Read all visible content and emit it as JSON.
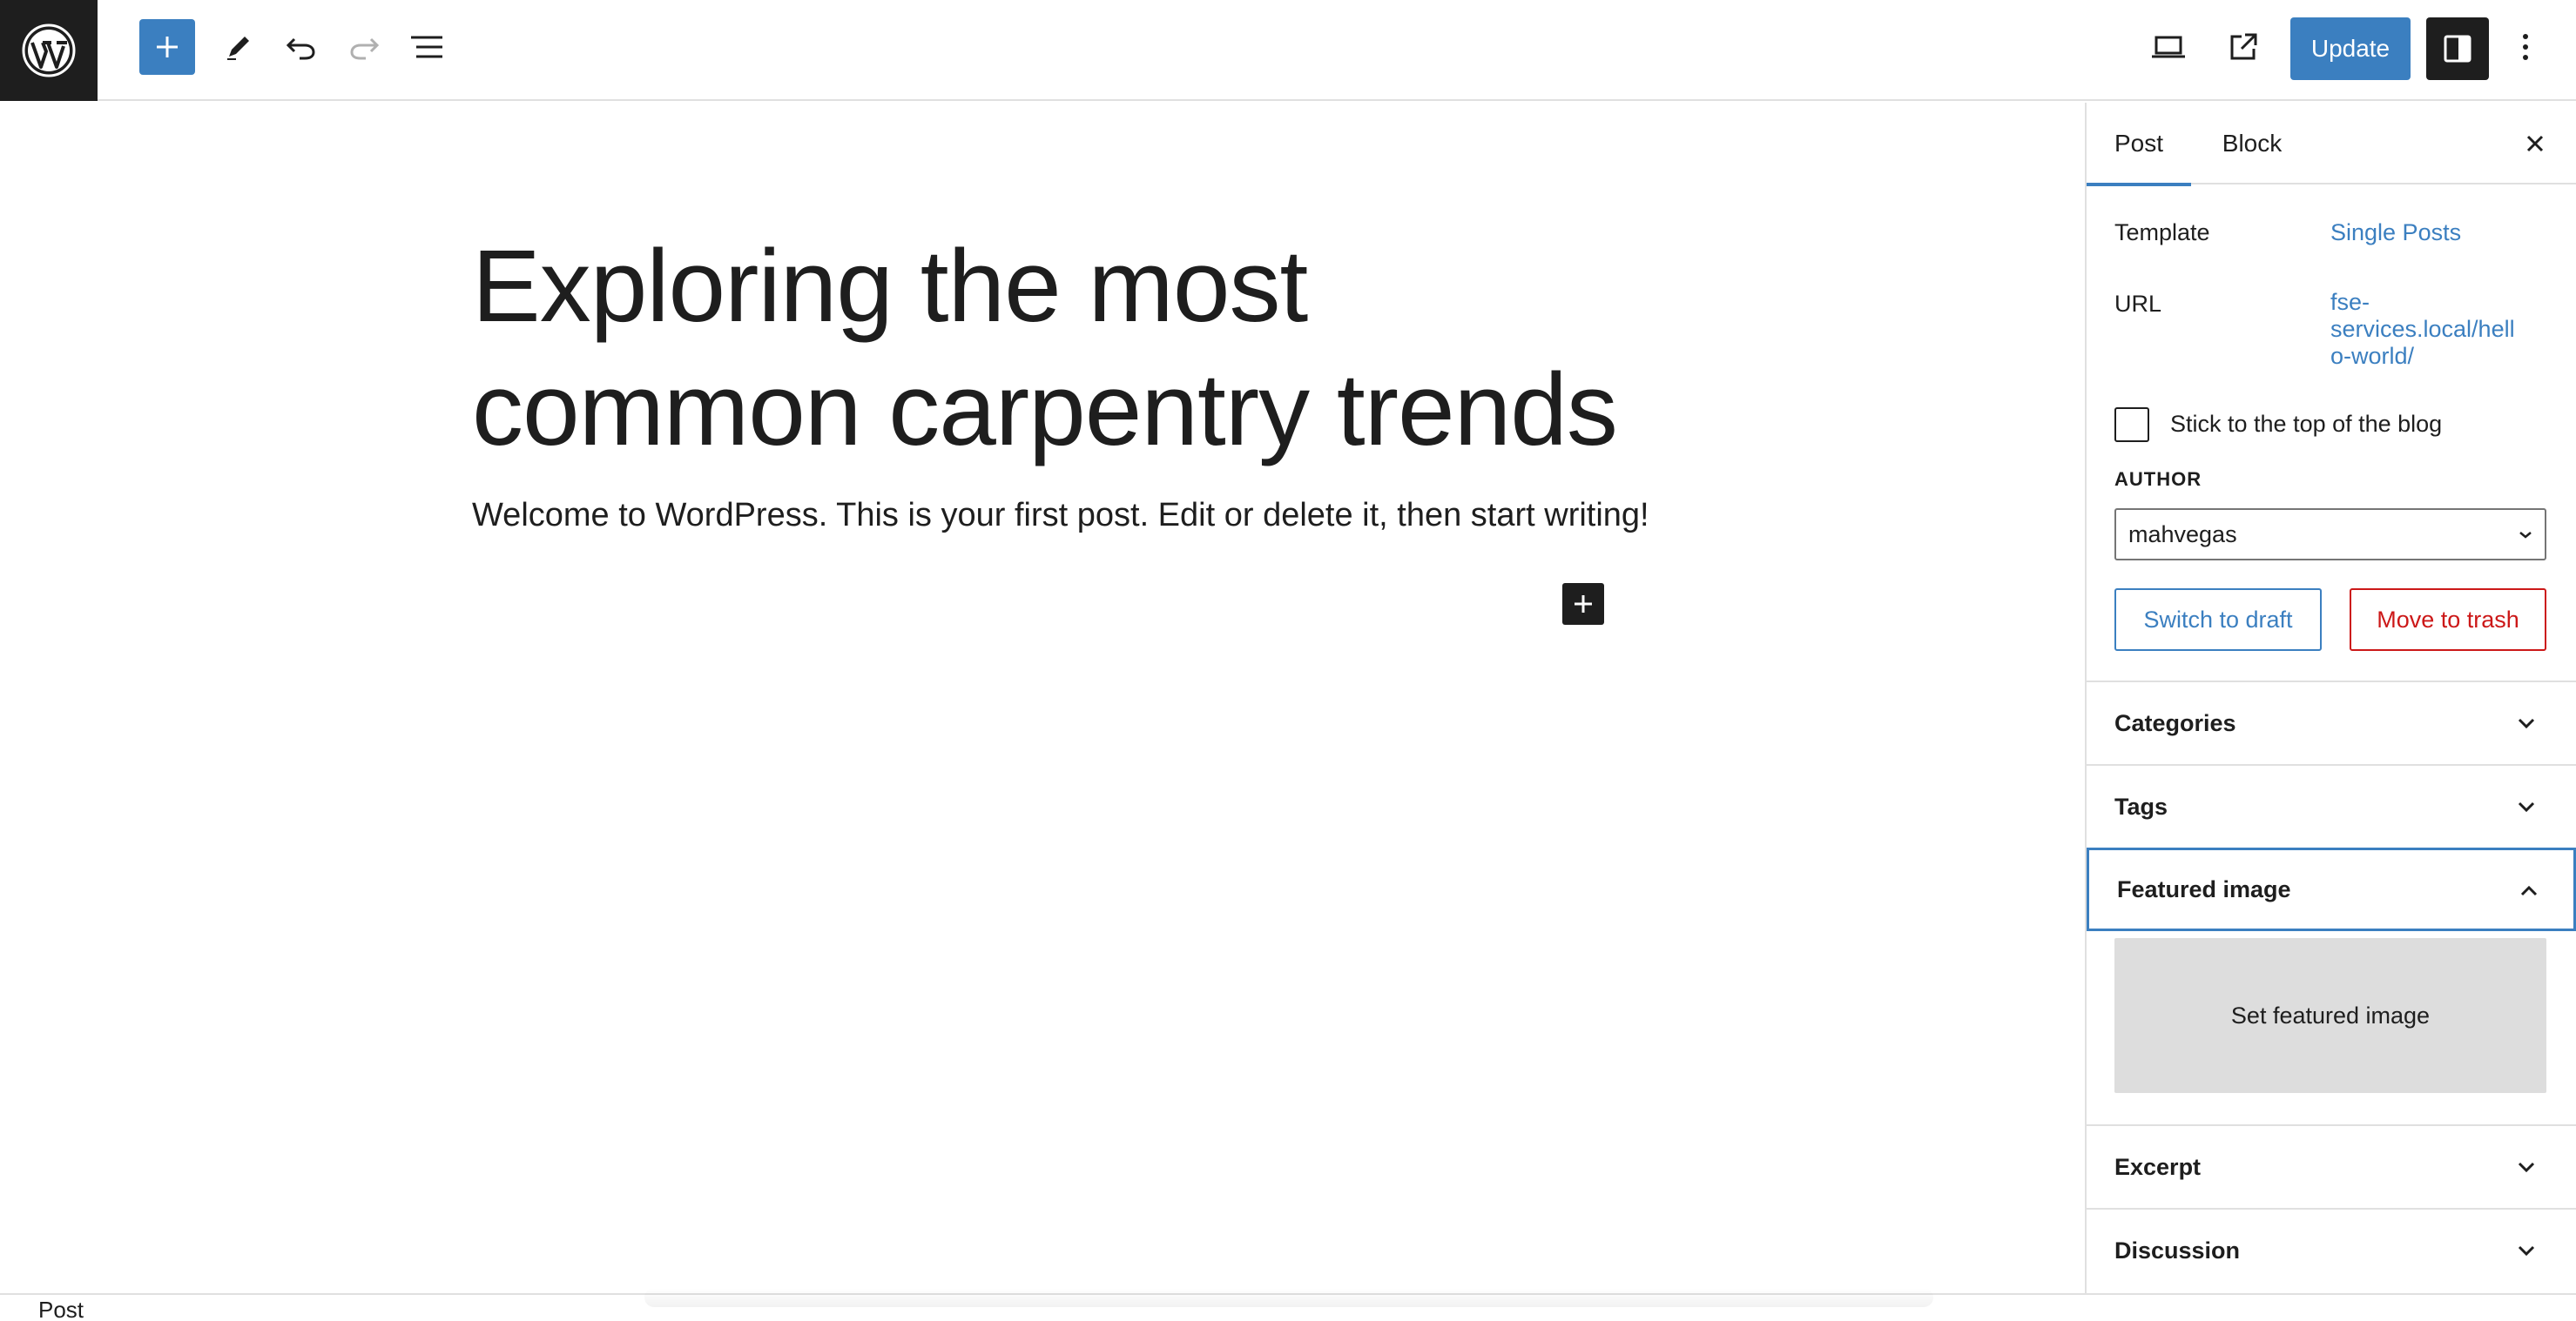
{
  "toolbar": {
    "logo": "wordpress-logo",
    "update_label": "Update"
  },
  "editor": {
    "title": "Exploring the most common carpentry trends",
    "paragraph": "Welcome to WordPress. This is your first post. Edit or delete it, then start writing!"
  },
  "sidebar": {
    "tabs": [
      {
        "label": "Post",
        "active": true
      },
      {
        "label": "Block",
        "active": false
      }
    ],
    "template": {
      "label": "Template",
      "value": "Single Posts"
    },
    "url": {
      "label": "URL",
      "value_line1": "fse-",
      "value_line2": "services.local/hell",
      "value_line3": "o-world/"
    },
    "sticky_label": "Stick to the top of the blog",
    "sticky_checked": false,
    "author": {
      "label": "AUTHOR",
      "selected": "mahvegas"
    },
    "switch_draft_label": "Switch to draft",
    "move_trash_label": "Move to trash",
    "panels": {
      "categories": "Categories",
      "tags": "Tags",
      "featured_image": "Featured image",
      "set_featured_image": "Set featured image",
      "excerpt": "Excerpt",
      "discussion": "Discussion"
    }
  },
  "footer": {
    "breadcrumb": "Post"
  },
  "colors": {
    "accent": "#3b7fc0",
    "danger": "#cc1818",
    "dark": "#1e1e1e"
  }
}
